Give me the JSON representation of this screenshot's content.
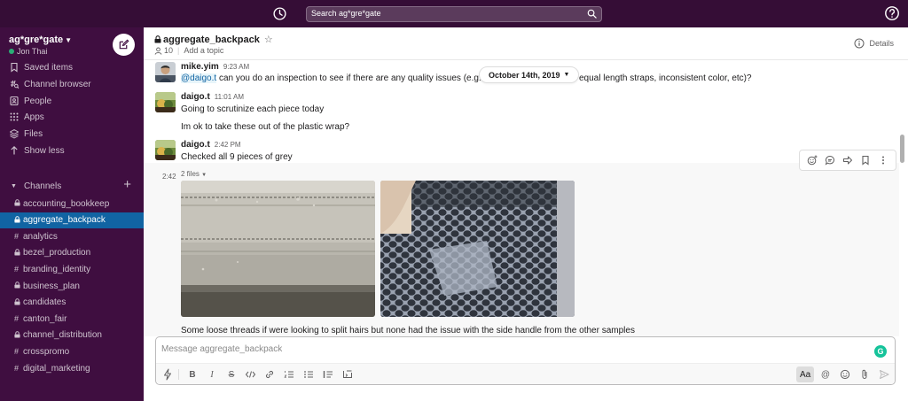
{
  "workspace": {
    "name": "ag*gre*gate",
    "user": "Jon Thai"
  },
  "search": {
    "placeholder": "Search ag*gre*gate"
  },
  "nav": [
    {
      "label": "Saved items",
      "icon": "bookmark-icon"
    },
    {
      "label": "Channel browser",
      "icon": "channel-browser-icon"
    },
    {
      "label": "People",
      "icon": "people-icon"
    },
    {
      "label": "Apps",
      "icon": "apps-icon"
    },
    {
      "label": "Files",
      "icon": "files-icon"
    },
    {
      "label": "Show less",
      "icon": "arrow-up-icon"
    }
  ],
  "channels_header": "Channels",
  "channels": [
    {
      "name": "accounting_bookkeep",
      "private": true
    },
    {
      "name": "aggregate_backpack",
      "private": true,
      "active": true
    },
    {
      "name": "analytics",
      "private": false
    },
    {
      "name": "bezel_production",
      "private": true
    },
    {
      "name": "branding_identity",
      "private": false
    },
    {
      "name": "business_plan",
      "private": true
    },
    {
      "name": "candidates",
      "private": true
    },
    {
      "name": "canton_fair",
      "private": false
    },
    {
      "name": "channel_distribution",
      "private": true
    },
    {
      "name": "crosspromo",
      "private": false
    },
    {
      "name": "digital_marketing",
      "private": false
    }
  ],
  "channel": {
    "name": "aggregate_backpack",
    "members": "10",
    "topic": "Add a topic",
    "details": "Details"
  },
  "date_divider": "October 14th, 2019",
  "messages": [
    {
      "author": "mike.yim",
      "time": "9:23 AM",
      "mention": "@daigo.t",
      "text_a": " can you do an inspection to see if there are any quality issues (e.g. s",
      "text_b": "equal length straps, inconsistent color, etc)?"
    },
    {
      "author": "daigo.t",
      "time": "11:01 AM",
      "line1": "Going to scrutinize each piece today",
      "line2": "Im ok to take these out of the plastic wrap?"
    },
    {
      "author": "daigo.t",
      "time": "2:42 PM",
      "line1": "Checked all 9 pieces of grey",
      "hover_time": "2:42",
      "files_label": "2 files",
      "line2": "Some loose threads if were looking to split hairs but none had the issue with the side handle from the other samples"
    }
  ],
  "composer": {
    "placeholder": "Message aggregate_backpack",
    "aa": "Aa",
    "grammarly": "G"
  },
  "colors": {
    "sidebar": "#3f0e40",
    "topbar": "#350d36",
    "active_channel": "#1164a3",
    "link": "#1264a3"
  }
}
